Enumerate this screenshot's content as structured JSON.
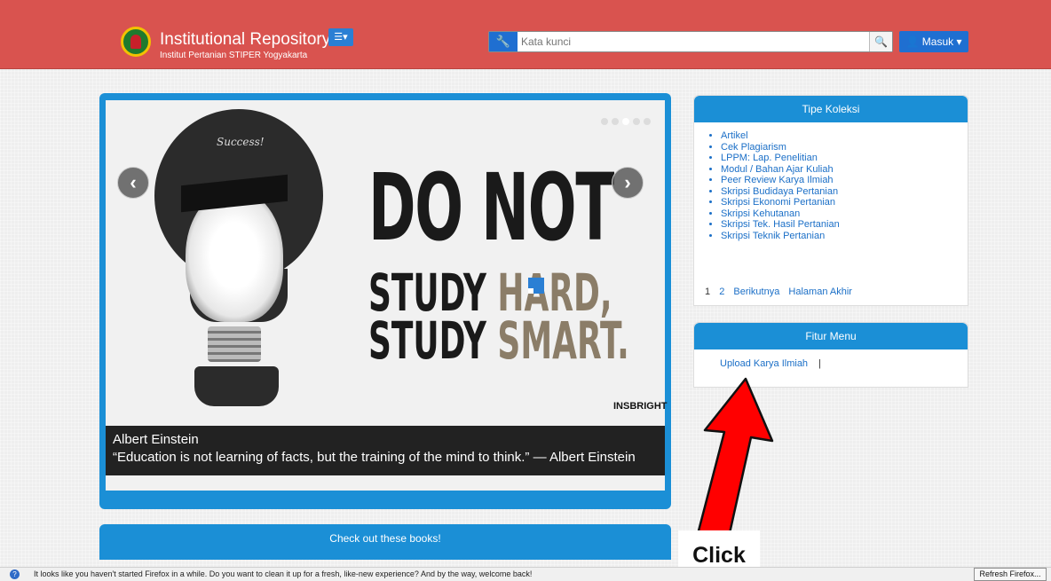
{
  "header": {
    "title": "Institutional Repository",
    "subtitle": "Institut Pertanian STIPER Yogyakarta",
    "menu_icon": "list-icon",
    "search_placeholder": "Kata kunci",
    "login_label": "Masuk",
    "colors": {
      "bar": "#d9534f",
      "accent": "#1f6fd1"
    }
  },
  "slider": {
    "slogan_line1": "DO NOT",
    "slogan_line2a": "STUDY ",
    "slogan_line2b": "HARD,",
    "slogan_line3a": "STUDY ",
    "slogan_line3b": "SMART.",
    "image_text_success": "Success!",
    "brandmark": "INSBRIGHT",
    "caption_title": "Albert Einstein",
    "caption_quote": "“Education is not learning of facts, but the training of the mind to think.” — Albert Einstein",
    "prev_icon": "chevron-left-icon",
    "next_icon": "chevron-right-icon"
  },
  "books": {
    "title": "Check out these books!"
  },
  "tipe_koleksi": {
    "title": "Tipe Koleksi",
    "items": [
      "Artikel",
      "Cek Plagiarism",
      "LPPM: Lap. Penelitian",
      "Modul / Bahan Ajar Kuliah",
      "Peer Review Karya Ilmiah",
      "Skripsi Budidaya Pertanian",
      "Skripsi Ekonomi Pertanian",
      "Skripsi Kehutanan",
      "Skripsi Tek. Hasil Pertanian",
      "Skripsi Teknik Pertanian"
    ],
    "pager": {
      "current": "1",
      "page2": "2",
      "next": "Berikutnya",
      "last": "Halaman Akhir"
    }
  },
  "fitur_menu": {
    "title": "Fitur Menu",
    "link": "Upload Karya Ilmiah",
    "separator": "|"
  },
  "annotation": {
    "label": "Click",
    "arrow_color": "#ff0000"
  },
  "notification": {
    "text": "It looks like you haven't started Firefox in a while. Do you want to clean it up for a fresh, like-new experience? And by the way, welcome back!",
    "button": "Refresh Firefox..."
  }
}
